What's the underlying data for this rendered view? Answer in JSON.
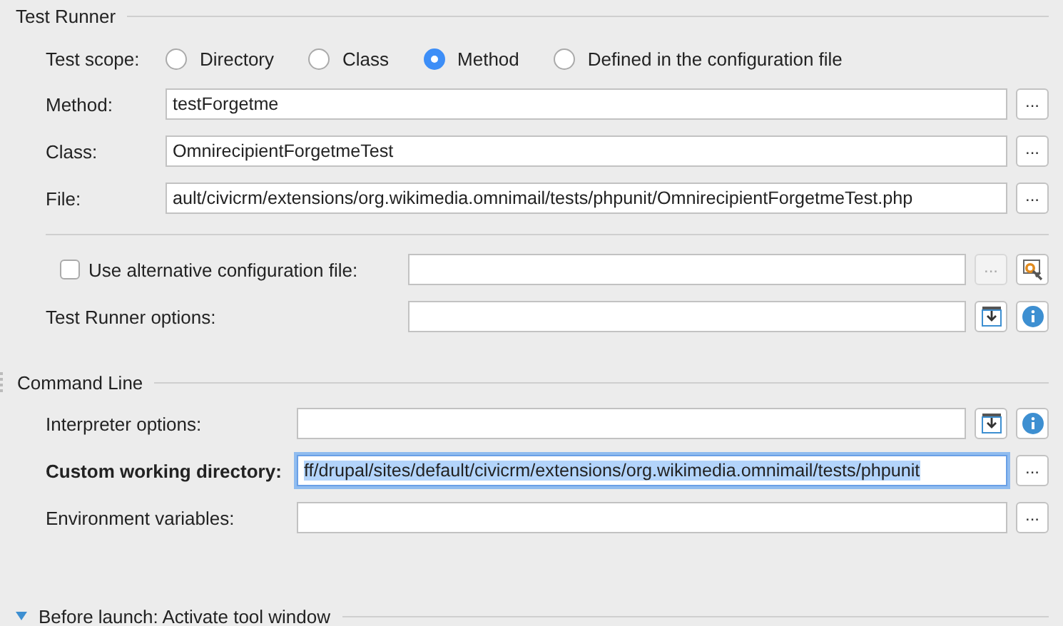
{
  "test_runner": {
    "title": "Test Runner",
    "scope": {
      "label": "Test scope:",
      "options": [
        {
          "label": "Directory",
          "selected": false
        },
        {
          "label": "Class",
          "selected": false
        },
        {
          "label": "Method",
          "selected": true
        },
        {
          "label": "Defined in the configuration file",
          "selected": false
        }
      ]
    },
    "fields": [
      {
        "label": "Method:",
        "value": "testForgetme",
        "button": "..."
      },
      {
        "label": "Class:",
        "value": "OmnirecipientForgetmeTest",
        "button": "..."
      },
      {
        "label": "File:",
        "value": "ault/civicrm/extensions/org.wikimedia.omnimail/tests/phpunit/OmnirecipientForgetmeTest.php",
        "button": "..."
      }
    ],
    "alt_config": {
      "label": "Use alternative configuration file:",
      "checked": false,
      "button": "...",
      "button_disabled": true
    },
    "options": {
      "label": "Test Runner options:"
    }
  },
  "command_line": {
    "title": "Command Line",
    "fields": [
      {
        "kind": "options",
        "label": "Interpreter options:",
        "focused": false
      },
      {
        "kind": "browse",
        "label": "Custom working directory:",
        "value": "ff/drupal/sites/default/civicrm/extensions/org.wikimedia.omnimail/tests/phpunit",
        "button": "...",
        "focused": true
      },
      {
        "kind": "browse",
        "label": "Environment variables:",
        "button": "...",
        "focused": false
      }
    ]
  },
  "before_launch": {
    "title": "Before launch: Activate tool window",
    "expanded": true
  }
}
